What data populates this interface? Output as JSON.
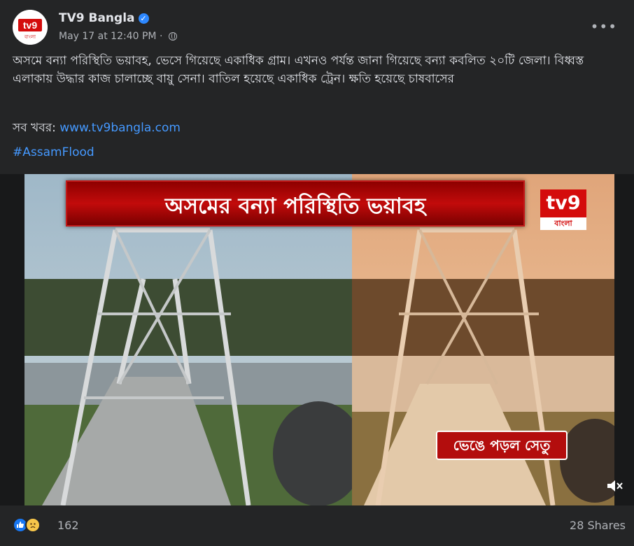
{
  "header": {
    "page_name": "TV9 Bangla",
    "timestamp": "May 17 at 12:40 PM",
    "privacy_icon": "globe-icon",
    "more_icon": "more-options-icon",
    "avatar_text": "tv9",
    "avatar_sub": "বাংলা"
  },
  "post": {
    "text": "অসমে বন্যা পরিস্থিতি ভয়াবহ, ভেসে গিয়েছে একাধিক গ্রাম। এখনও পর্যন্ত জানা গিয়েছে বন্যা কবলিত ২০টি জেলা। বিধ্বস্ত এলাকায় উদ্ধার কাজ চালাচ্ছে বায়ু সেনা। বাতিল হয়েছে একাধিক ট্রেন। ক্ষতি হয়েছে চাষবাসের",
    "more_news_label": "সব খবর:",
    "link": "www.tv9bangla.com",
    "hashtag": "#AssamFlood"
  },
  "video": {
    "banner": "অসমের বন্যা পরিস্থিতি ভয়াবহ",
    "logo_main": "tv9",
    "logo_sub": "বাংলা",
    "caption": "ভেঙে পড়ল সেতু",
    "mute_icon": "volume-muted-icon"
  },
  "footer": {
    "reaction_icons": [
      "like-icon",
      "sad-icon"
    ],
    "reaction_count": "162",
    "shares": "28 Shares"
  },
  "colors": {
    "background": "#242526",
    "link": "#4599ff",
    "brand_red": "#d40c0c"
  }
}
